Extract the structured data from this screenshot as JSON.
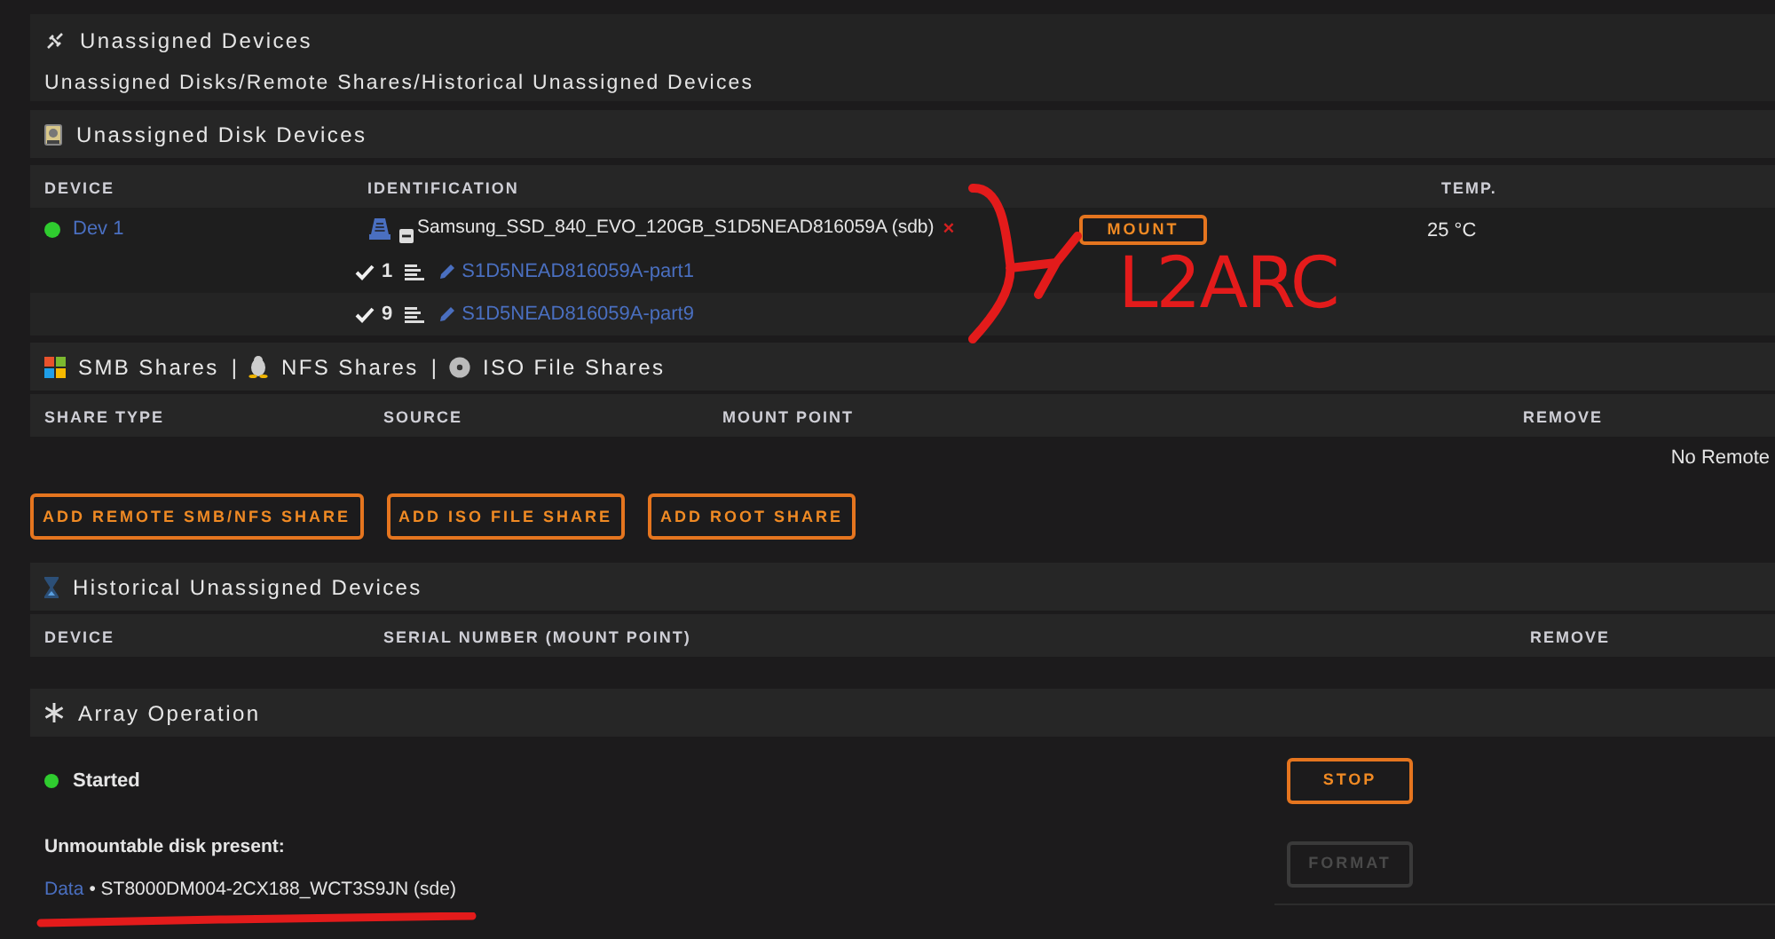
{
  "header": {
    "title": "Unassigned Devices",
    "subtitle": "Unassigned Disks/Remote Shares/Historical Unassigned Devices"
  },
  "disk_section": {
    "title": "Unassigned Disk Devices",
    "columns": [
      "DEVICE",
      "IDENTIFICATION",
      "TEMP."
    ],
    "device": {
      "online": true,
      "name": "Dev 1",
      "identification": "Samsung_SSD_840_EVO_120GB_S1D5NEAD816059A (sdb)",
      "remove_mark": "×",
      "mount_button": "MOUNT",
      "temp": "25 °C",
      "partitions": [
        {
          "checked": true,
          "number": "1",
          "name": "S1D5NEAD816059A-part1"
        },
        {
          "checked": true,
          "number": "9",
          "name": "S1D5NEAD816059A-part9"
        }
      ]
    }
  },
  "shares_section": {
    "title_parts": [
      {
        "kind": "label",
        "text": "SMB Shares"
      },
      {
        "kind": "separator",
        "text": "|"
      },
      {
        "kind": "label",
        "text": "NFS Shares"
      },
      {
        "kind": "separator",
        "text": "|"
      },
      {
        "kind": "label",
        "text": "ISO File Shares"
      }
    ],
    "columns": [
      "SHARE TYPE",
      "SOURCE",
      "MOUNT POINT",
      "REMOVE"
    ],
    "empty_text": "No Remote",
    "buttons": [
      "ADD REMOTE SMB/NFS SHARE",
      "ADD ISO FILE SHARE",
      "ADD ROOT SHARE"
    ]
  },
  "history_section": {
    "title": "Historical Unassigned Devices",
    "columns": [
      "DEVICE",
      "SERIAL NUMBER (MOUNT POINT)",
      "REMOVE"
    ]
  },
  "array_section": {
    "title": "Array Operation",
    "running": true,
    "status": "Started",
    "warning": "Unmountable disk present:",
    "disk_link": "Data",
    "disk_text": "• ST8000DM004-2CX188_WCT3S9JN (sde)",
    "buttons": [
      {
        "label": "STOP",
        "disabled": false
      },
      {
        "label": "FORMAT",
        "disabled": true
      }
    ]
  },
  "annotation": {
    "text": "L2ARC"
  }
}
